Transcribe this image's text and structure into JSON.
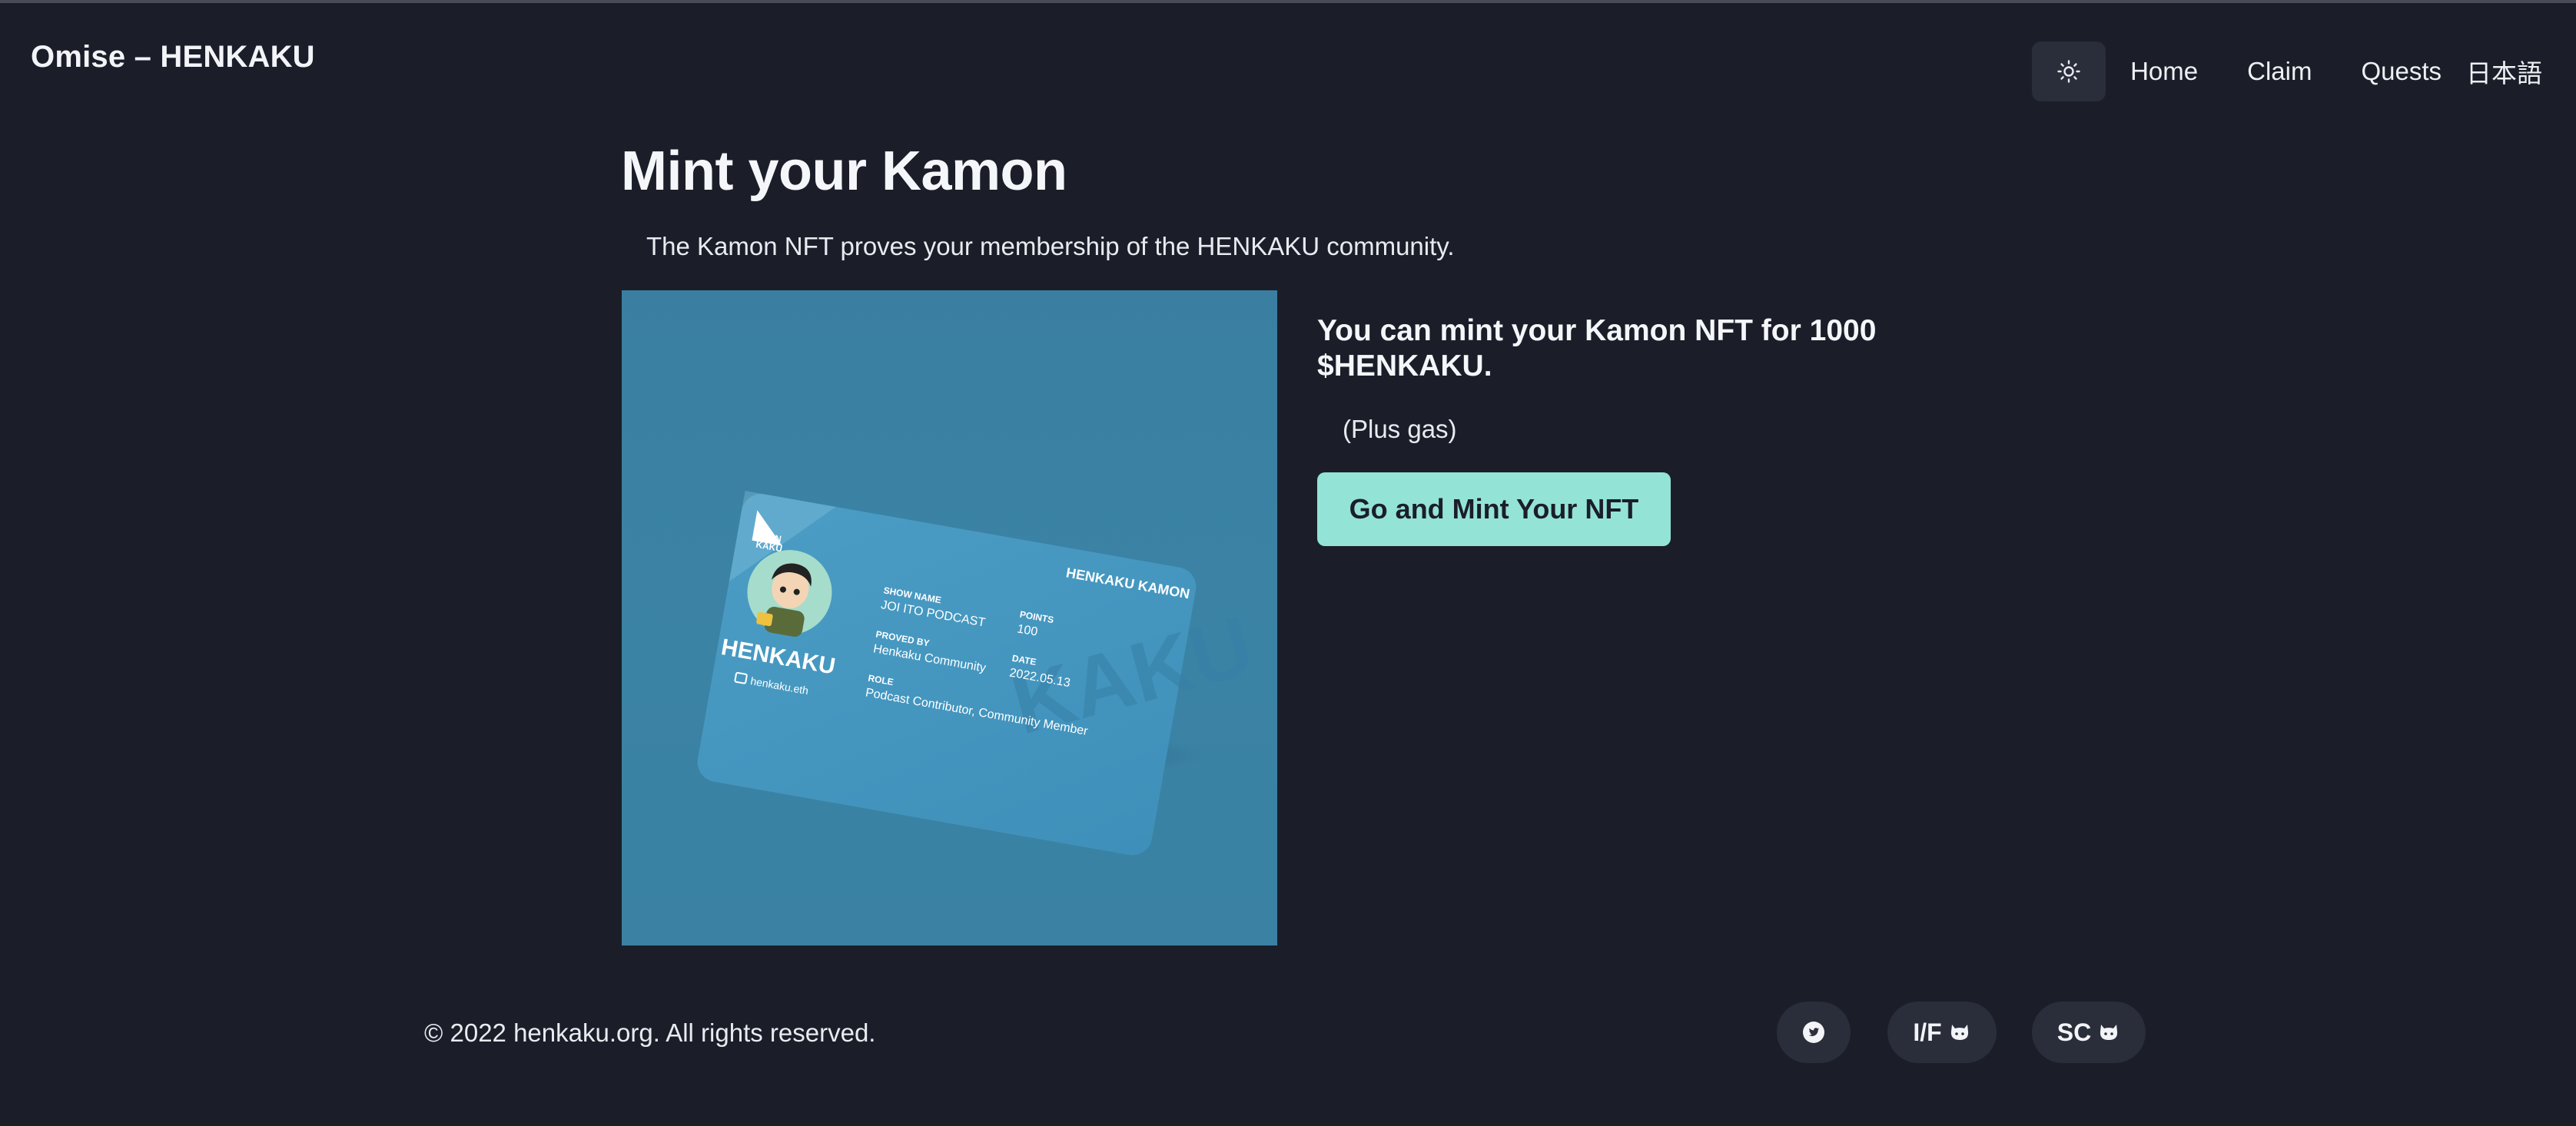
{
  "header": {
    "brand": "Omise – HENKAKU",
    "theme_icon": "sun-icon",
    "nav": {
      "home": "Home",
      "claim": "Claim",
      "quests": "Quests",
      "language": "日本語"
    }
  },
  "main": {
    "title": "Mint your Kamon",
    "subtitle": "The Kamon NFT proves your membership of the HENKAKU community.",
    "card": {
      "logo_text_1": "HEN",
      "logo_text_2": "KAKU",
      "header": "HENKAKU KAMON",
      "name": "HENKAKU",
      "ens": "henkaku.eth",
      "show_name_label": "SHOW NAME",
      "show_name": "JOI ITO PODCAST",
      "points_label": "POINTS",
      "points": "100",
      "proved_by_label": "PROVED BY",
      "proved_by": "Henkaku Community",
      "date_label": "DATE",
      "date": "2022.05.13",
      "role_label": "ROLE",
      "role": "Podcast Contributor, Community Member"
    },
    "mint_heading": "You can mint your Kamon NFT for 1000 $HENKAKU.",
    "plus_gas": "(Plus gas)",
    "mint_button": "Go and Mint Your NFT"
  },
  "footer": {
    "copyright": "© 2022 henkaku.org. All rights reserved.",
    "twitter_icon": "twitter-icon",
    "if_label": "I/F",
    "sc_label": "SC",
    "github_icon": "github-icon"
  },
  "colors": {
    "background": "#1b1e29",
    "accent": "#94e3d7",
    "card_blue": "#3a7fa1",
    "surface": "#2a2e3a"
  }
}
